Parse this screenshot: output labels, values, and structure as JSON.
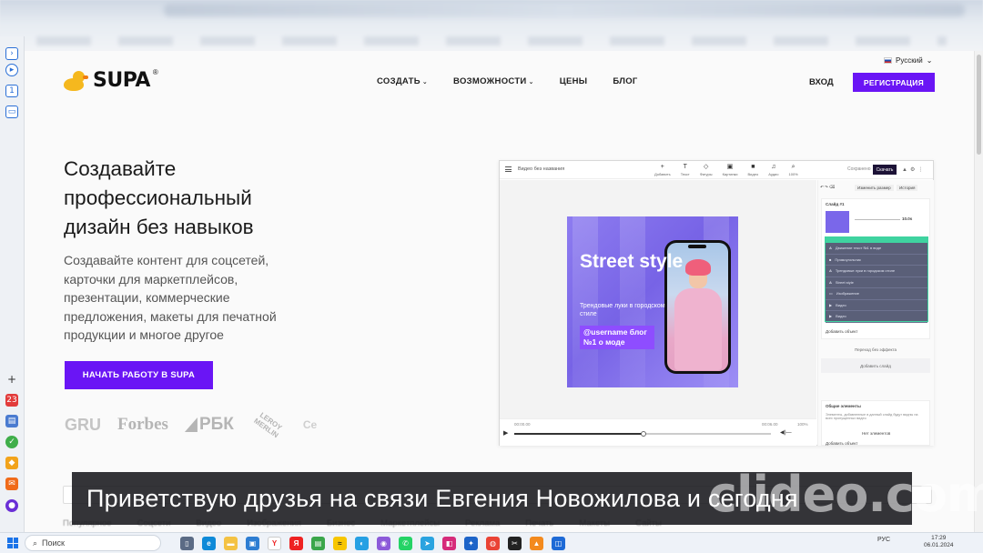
{
  "header": {
    "logo_text": "SUPA",
    "logo_reg": "®",
    "nav": [
      {
        "label": "СОЗДАТЬ",
        "has_dropdown": true
      },
      {
        "label": "ВОЗМОЖНОСТИ",
        "has_dropdown": true
      },
      {
        "label": "ЦЕНЫ",
        "has_dropdown": false
      },
      {
        "label": "БЛОГ",
        "has_dropdown": false
      }
    ],
    "language": "Русский",
    "login_label": "ВХОД",
    "signup_label": "РЕГИСТРАЦИЯ"
  },
  "hero": {
    "title_lines": [
      "Создавайте",
      "профессиональный",
      "дизайн без навыков"
    ],
    "subtitle_lines": [
      "Создавайте контент для соцсетей,",
      "карточки для маркетплейсов,",
      "презентации, коммерческие",
      "предложения, макеты для печатной",
      "продукции и многое другое"
    ],
    "cta_label": "НАЧАТЬ РАБОТУ В SUPA"
  },
  "brands": [
    "GRU",
    "Forbes",
    "РБК",
    "LEROY MERLIN",
    "Ce"
  ],
  "editor": {
    "doc_title": "Видео без названия",
    "tools": [
      {
        "icon": "+",
        "label": "Добавить"
      },
      {
        "icon": "T",
        "label": "Текст"
      },
      {
        "icon": "◇",
        "label": "Фигуры"
      },
      {
        "icon": "▣",
        "label": "Картинки"
      },
      {
        "icon": "■",
        "label": "Видео"
      },
      {
        "icon": "♫",
        "label": "Аудио"
      },
      {
        "icon": "⌕",
        "label": "100%"
      }
    ],
    "saved_label": "Сохранено",
    "download_label": "Скачать",
    "design": {
      "headline": "Street style",
      "caption": "Трендовые луки в городском стиле",
      "tag": "@username блог №1 о моде"
    },
    "timeline": {
      "current": "00:00.00",
      "total": "00:06.00",
      "zoom": "100%"
    },
    "panel": {
      "resize_label": "Изменить размер",
      "history_label": "История",
      "slide_label": "Слайд #1",
      "duration": "10.0s",
      "layers": [
        "Движение текст №1 в виде",
        "Прямоугольник",
        "Трендовые луки в городском стиле",
        "Street style",
        "Изображение",
        "Видео",
        "Видео"
      ],
      "add_object": "Добавить объект",
      "transition": "Переход без эффекта",
      "add_slide": "Добавить слайд",
      "common_elements": "Общие элементы",
      "common_desc": "Элементы, добавленные в данный слайд будут видны на всех пропущенных видео",
      "no_elements": "Нет элементов",
      "add_object2": "Добавить объект"
    }
  },
  "below": {
    "categories": [
      "Популярное",
      "Соцсети",
      "Видео",
      "Изображения",
      "Бизнес",
      "Маркетплейсы",
      "Реклама",
      "Печать",
      "Макеты",
      "Сайты"
    ]
  },
  "subtitle_text": "Приветствую друзья на связи Евгения Новожилова и сегодня",
  "watermark": "clideo.com",
  "taskbar": {
    "search_label": "Поиск",
    "lang": "РУС",
    "time": "17:29",
    "date": "06.01.2024"
  },
  "side_badges": [
    "23"
  ],
  "colors": {
    "accent": "#6a15f5",
    "logo_yellow": "#f5b81e",
    "text": "#1a1a1a"
  }
}
